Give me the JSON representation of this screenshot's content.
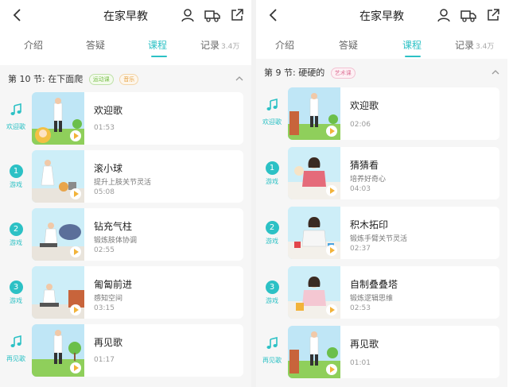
{
  "theme": {
    "accent": "#2cc1c5",
    "play": "#f2b33a",
    "background": "#f6f6f6"
  },
  "panels": [
    {
      "title": "在家早教",
      "tabs": [
        {
          "label": "介绍"
        },
        {
          "label": "答疑"
        },
        {
          "label": "课程",
          "active": true
        },
        {
          "label": "记录",
          "count": "3.4万"
        }
      ],
      "section": {
        "title": "第 10 节: 在下面爬",
        "tags": [
          {
            "text": "运动课",
            "color": "green"
          },
          {
            "text": "音乐",
            "color": "orange"
          }
        ]
      },
      "items": [
        {
          "side": "note",
          "side_label": "欢迎歌",
          "title": "欢迎歌",
          "desc": "",
          "time": "01:53",
          "thumb": "welcome"
        },
        {
          "side": "1",
          "side_label": "游戏",
          "title": "滚小球",
          "desc": "提升上肢关节灵活",
          "time": "05:08",
          "thumb": "kneel"
        },
        {
          "side": "2",
          "side_label": "游戏",
          "title": "钻充气柱",
          "desc": "锻炼肢体协调",
          "time": "02:55",
          "thumb": "tube"
        },
        {
          "side": "3",
          "side_label": "游戏",
          "title": "匍匐前进",
          "desc": "感知空间",
          "time": "03:15",
          "thumb": "crawl"
        },
        {
          "side": "note",
          "side_label": "再见歌",
          "title": "再见歌",
          "desc": "",
          "time": "01:17",
          "thumb": "bye"
        }
      ]
    },
    {
      "title": "在家早教",
      "tabs": [
        {
          "label": "介绍"
        },
        {
          "label": "答疑"
        },
        {
          "label": "课程",
          "active": true
        },
        {
          "label": "记录",
          "count": "3.4万"
        }
      ],
      "section": {
        "title": "第 9 节: 硬硬的",
        "tags": [
          {
            "text": "艺术课",
            "color": "pink"
          }
        ]
      },
      "items": [
        {
          "side": "note",
          "side_label": "欢迎歌",
          "title": "欢迎歌",
          "desc": "",
          "time": "02:06",
          "thumb": "welcome"
        },
        {
          "side": "1",
          "side_label": "游戏",
          "title": "猜猜看",
          "desc": "培养好奇心",
          "time": "04:03",
          "thumb": "table"
        },
        {
          "side": "2",
          "side_label": "游戏",
          "title": "积木拓印",
          "desc": "锻炼手臂关节灵活",
          "time": "02:37",
          "thumb": "table"
        },
        {
          "side": "3",
          "side_label": "游戏",
          "title": "自制叠叠塔",
          "desc": "锻炼逻辑思维",
          "time": "02:53",
          "thumb": "table2"
        },
        {
          "side": "note",
          "side_label": "再见歌",
          "title": "再见歌",
          "desc": "",
          "time": "01:01",
          "thumb": "bye"
        }
      ]
    }
  ]
}
